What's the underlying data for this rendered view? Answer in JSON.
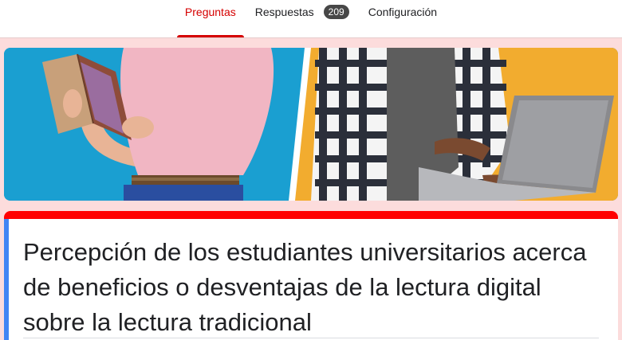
{
  "tabs": [
    {
      "label": "Preguntas",
      "active": true
    },
    {
      "label": "Respuestas",
      "badge": "209"
    },
    {
      "label": "Configuración"
    }
  ],
  "form": {
    "title": "Percepción de los estudiantes universitarios acerca de beneficios o desventajas de la lectura digital sobre la lectura tradicional"
  },
  "colors": {
    "accent": "#d50000",
    "page_background": "#fcdcdc",
    "card_top_stripe": "#ff0000",
    "card_focus_stripe": "#4285f4",
    "banner_left_bg": "#1a9fd1",
    "banner_right_bg": "#f2ac2f"
  }
}
